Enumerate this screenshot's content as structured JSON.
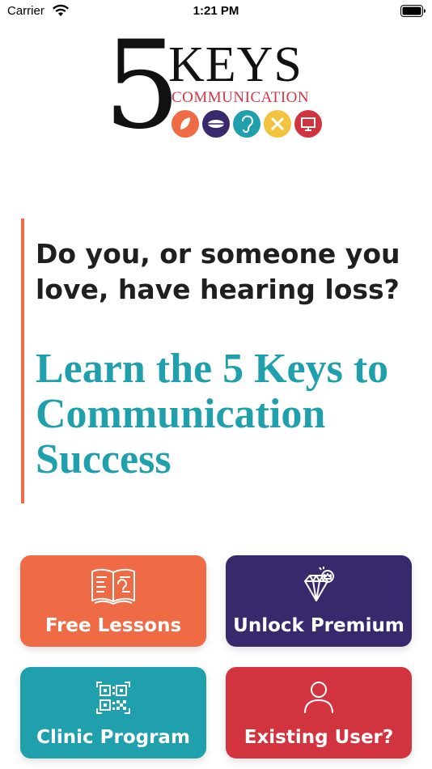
{
  "status_bar": {
    "carrier": "Carrier",
    "time": "1:21 PM"
  },
  "logo": {
    "numeral": "5",
    "word": "KEYS",
    "subtitle": "COMMUNICATION"
  },
  "headline": {
    "question": "Do you, or someone you love, have hearing loss?",
    "tagline": "Learn the 5 Keys to Communication Success"
  },
  "buttons": {
    "free_lessons": "Free Lessons",
    "unlock_premium": "Unlock Premium",
    "clinic_program": "Clinic Program",
    "existing_user": "Existing User?"
  },
  "colors": {
    "orange": "#ee6b46",
    "purple": "#37296b",
    "teal": "#1fa0ac",
    "yellow": "#f2c33e",
    "red": "#d1333f"
  },
  "icons": {
    "logo_keys": [
      "leaf-icon",
      "lips-icon",
      "ear-icon",
      "tools-icon",
      "monitor-icon"
    ],
    "free_lessons": "book-ear-icon",
    "unlock_premium": "diamond-crown-icon",
    "clinic_program": "qr-code-icon",
    "existing_user": "user-icon"
  }
}
